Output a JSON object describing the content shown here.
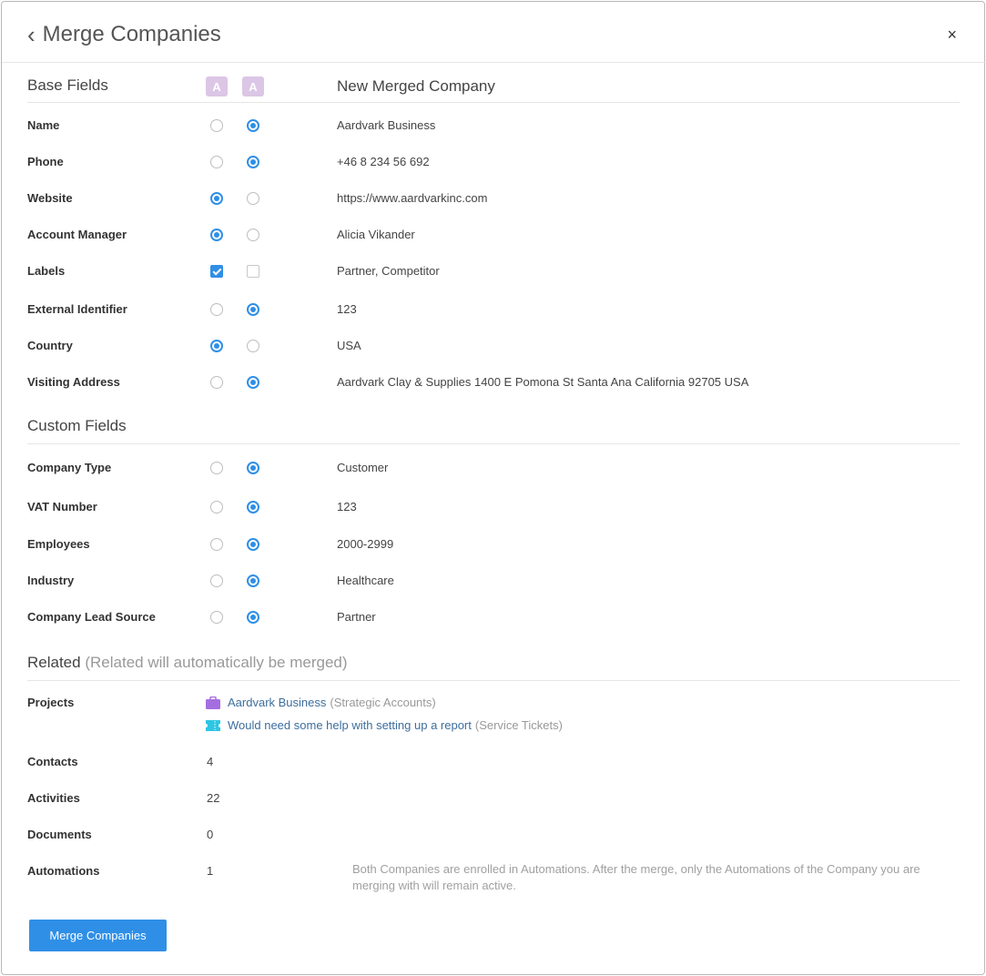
{
  "dialog": {
    "title": "Merge Companies",
    "back_icon": "chevron-left-icon",
    "close_label": "×"
  },
  "base_section": {
    "title": "Base Fields",
    "badge_a": "A",
    "badge_b": "A",
    "merged_header": "New Merged Company"
  },
  "base_fields": [
    {
      "label": "Name",
      "control": "radio",
      "selected": "b",
      "value": "Aardvark Business"
    },
    {
      "label": "Phone",
      "control": "radio",
      "selected": "b",
      "value": "+46 8 234 56 692"
    },
    {
      "label": "Website",
      "control": "radio",
      "selected": "a",
      "value": "https://www.aardvarkinc.com"
    },
    {
      "label": "Account Manager",
      "control": "radio",
      "selected": "a",
      "value": "Alicia Vikander"
    },
    {
      "label": "Labels",
      "control": "checkbox",
      "selected": "a",
      "value": "Partner, Competitor"
    },
    {
      "label": "External Identifier",
      "control": "radio",
      "selected": "b",
      "value": "123"
    },
    {
      "label": "Country",
      "control": "radio",
      "selected": "a",
      "value": "USA"
    },
    {
      "label": "Visiting Address",
      "control": "radio",
      "selected": "b",
      "value": "Aardvark Clay & Supplies 1400 E Pomona St Santa Ana California 92705 USA"
    }
  ],
  "custom_section": {
    "title": "Custom Fields"
  },
  "custom_fields": [
    {
      "label": "Company Type",
      "control": "radio",
      "selected": "b",
      "value": "Customer"
    },
    {
      "label": "VAT Number",
      "control": "radio",
      "selected": "b",
      "value": "123"
    },
    {
      "label": "Employees",
      "control": "radio",
      "selected": "b",
      "value": "2000-2999"
    },
    {
      "label": "Industry",
      "control": "radio",
      "selected": "b",
      "value": "Healthcare"
    },
    {
      "label": "Company Lead Source",
      "control": "radio",
      "selected": "b",
      "value": "Partner"
    }
  ],
  "related_section": {
    "title": "Related",
    "subtitle": "(Related will automatically be merged)"
  },
  "projects": {
    "label": "Projects",
    "items": [
      {
        "icon": "briefcase-icon",
        "icon_color": "#a56ee0",
        "name": "Aardvark Business",
        "pipeline": "(Strategic Accounts)"
      },
      {
        "icon": "ticket-icon",
        "icon_color": "#2dc6e3",
        "name": "Would need some help with setting up a report",
        "pipeline": "(Service Tickets)"
      }
    ]
  },
  "related_counts": [
    {
      "label": "Contacts",
      "value": "4"
    },
    {
      "label": "Activities",
      "value": "22"
    },
    {
      "label": "Documents",
      "value": "0"
    },
    {
      "label": "Automations",
      "value": "1"
    }
  ],
  "automation_note": "Both Companies are enrolled in Automations. After the merge, only the Automations of the Company you are merging with will remain active.",
  "merge_button": "Merge Companies",
  "colors": {
    "accent": "#2f8fe6",
    "badge": "#dcc6e6",
    "link": "#3d6e9d"
  }
}
